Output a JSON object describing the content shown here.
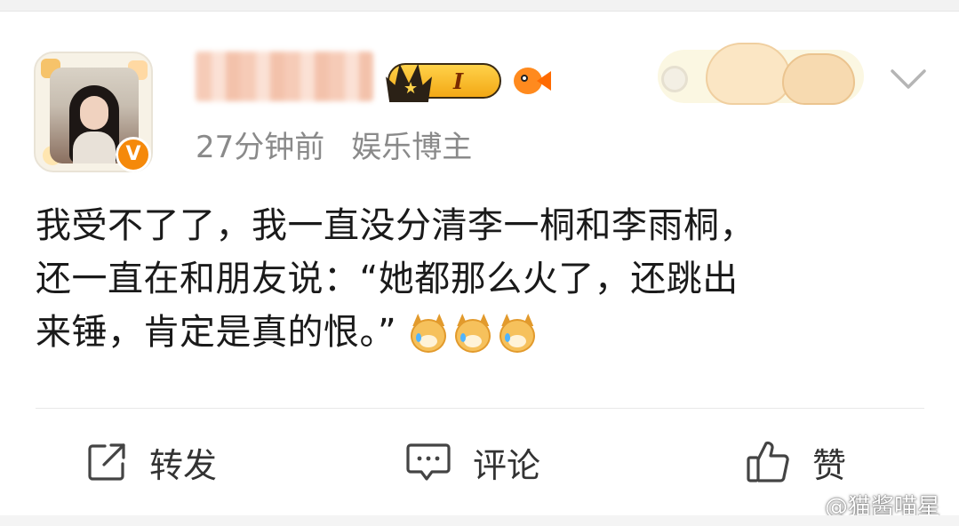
{
  "post": {
    "time": "27分钟前",
    "user_tag": "娱乐博主",
    "level_badge": "I",
    "verified_mark": "V",
    "lines": [
      "我受不了了，我一直没分清李一桐和李雨桐，",
      "还一直在和朋友说：“她都那么火了，还跳出",
      "来锤，肯定是真的恨。”"
    ],
    "emoji": [
      "crying-dog-emoji",
      "crying-dog-emoji",
      "crying-dog-emoji"
    ]
  },
  "actions": {
    "repost": "转发",
    "comment": "评论",
    "like": "赞"
  },
  "watermark": "@猫酱喵星",
  "colors": {
    "verified_orange": "#f5890a",
    "meta_gray": "#8a8a8a",
    "text": "#1a1a1a"
  },
  "icons": {
    "repost": "share-square-icon",
    "comment": "comment-bubble-icon",
    "like": "thumbs-up-icon",
    "more": "chevron-down-icon"
  }
}
